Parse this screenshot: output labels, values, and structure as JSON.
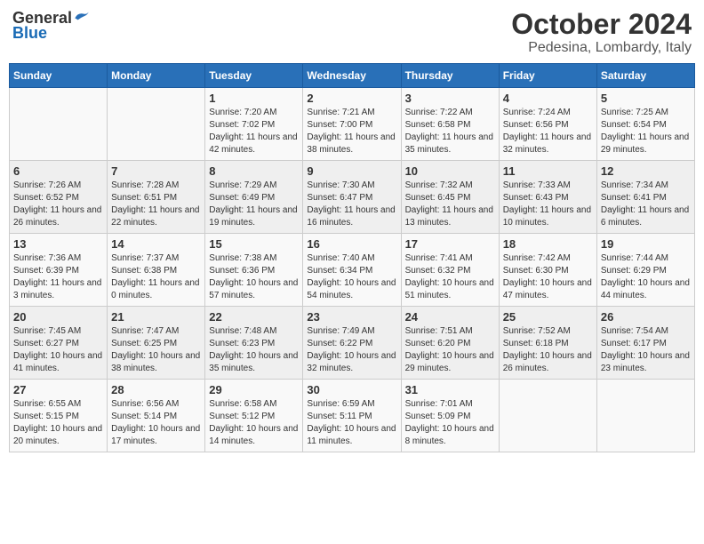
{
  "logo": {
    "general": "General",
    "blue": "Blue"
  },
  "header": {
    "month": "October 2024",
    "location": "Pedesina, Lombardy, Italy"
  },
  "weekdays": [
    "Sunday",
    "Monday",
    "Tuesday",
    "Wednesday",
    "Thursday",
    "Friday",
    "Saturday"
  ],
  "weeks": [
    [
      {
        "day": "",
        "content": ""
      },
      {
        "day": "",
        "content": ""
      },
      {
        "day": "1",
        "content": "Sunrise: 7:20 AM\nSunset: 7:02 PM\nDaylight: 11 hours and 42 minutes."
      },
      {
        "day": "2",
        "content": "Sunrise: 7:21 AM\nSunset: 7:00 PM\nDaylight: 11 hours and 38 minutes."
      },
      {
        "day": "3",
        "content": "Sunrise: 7:22 AM\nSunset: 6:58 PM\nDaylight: 11 hours and 35 minutes."
      },
      {
        "day": "4",
        "content": "Sunrise: 7:24 AM\nSunset: 6:56 PM\nDaylight: 11 hours and 32 minutes."
      },
      {
        "day": "5",
        "content": "Sunrise: 7:25 AM\nSunset: 6:54 PM\nDaylight: 11 hours and 29 minutes."
      }
    ],
    [
      {
        "day": "6",
        "content": "Sunrise: 7:26 AM\nSunset: 6:52 PM\nDaylight: 11 hours and 26 minutes."
      },
      {
        "day": "7",
        "content": "Sunrise: 7:28 AM\nSunset: 6:51 PM\nDaylight: 11 hours and 22 minutes."
      },
      {
        "day": "8",
        "content": "Sunrise: 7:29 AM\nSunset: 6:49 PM\nDaylight: 11 hours and 19 minutes."
      },
      {
        "day": "9",
        "content": "Sunrise: 7:30 AM\nSunset: 6:47 PM\nDaylight: 11 hours and 16 minutes."
      },
      {
        "day": "10",
        "content": "Sunrise: 7:32 AM\nSunset: 6:45 PM\nDaylight: 11 hours and 13 minutes."
      },
      {
        "day": "11",
        "content": "Sunrise: 7:33 AM\nSunset: 6:43 PM\nDaylight: 11 hours and 10 minutes."
      },
      {
        "day": "12",
        "content": "Sunrise: 7:34 AM\nSunset: 6:41 PM\nDaylight: 11 hours and 6 minutes."
      }
    ],
    [
      {
        "day": "13",
        "content": "Sunrise: 7:36 AM\nSunset: 6:39 PM\nDaylight: 11 hours and 3 minutes."
      },
      {
        "day": "14",
        "content": "Sunrise: 7:37 AM\nSunset: 6:38 PM\nDaylight: 11 hours and 0 minutes."
      },
      {
        "day": "15",
        "content": "Sunrise: 7:38 AM\nSunset: 6:36 PM\nDaylight: 10 hours and 57 minutes."
      },
      {
        "day": "16",
        "content": "Sunrise: 7:40 AM\nSunset: 6:34 PM\nDaylight: 10 hours and 54 minutes."
      },
      {
        "day": "17",
        "content": "Sunrise: 7:41 AM\nSunset: 6:32 PM\nDaylight: 10 hours and 51 minutes."
      },
      {
        "day": "18",
        "content": "Sunrise: 7:42 AM\nSunset: 6:30 PM\nDaylight: 10 hours and 47 minutes."
      },
      {
        "day": "19",
        "content": "Sunrise: 7:44 AM\nSunset: 6:29 PM\nDaylight: 10 hours and 44 minutes."
      }
    ],
    [
      {
        "day": "20",
        "content": "Sunrise: 7:45 AM\nSunset: 6:27 PM\nDaylight: 10 hours and 41 minutes."
      },
      {
        "day": "21",
        "content": "Sunrise: 7:47 AM\nSunset: 6:25 PM\nDaylight: 10 hours and 38 minutes."
      },
      {
        "day": "22",
        "content": "Sunrise: 7:48 AM\nSunset: 6:23 PM\nDaylight: 10 hours and 35 minutes."
      },
      {
        "day": "23",
        "content": "Sunrise: 7:49 AM\nSunset: 6:22 PM\nDaylight: 10 hours and 32 minutes."
      },
      {
        "day": "24",
        "content": "Sunrise: 7:51 AM\nSunset: 6:20 PM\nDaylight: 10 hours and 29 minutes."
      },
      {
        "day": "25",
        "content": "Sunrise: 7:52 AM\nSunset: 6:18 PM\nDaylight: 10 hours and 26 minutes."
      },
      {
        "day": "26",
        "content": "Sunrise: 7:54 AM\nSunset: 6:17 PM\nDaylight: 10 hours and 23 minutes."
      }
    ],
    [
      {
        "day": "27",
        "content": "Sunrise: 6:55 AM\nSunset: 5:15 PM\nDaylight: 10 hours and 20 minutes."
      },
      {
        "day": "28",
        "content": "Sunrise: 6:56 AM\nSunset: 5:14 PM\nDaylight: 10 hours and 17 minutes."
      },
      {
        "day": "29",
        "content": "Sunrise: 6:58 AM\nSunset: 5:12 PM\nDaylight: 10 hours and 14 minutes."
      },
      {
        "day": "30",
        "content": "Sunrise: 6:59 AM\nSunset: 5:11 PM\nDaylight: 10 hours and 11 minutes."
      },
      {
        "day": "31",
        "content": "Sunrise: 7:01 AM\nSunset: 5:09 PM\nDaylight: 10 hours and 8 minutes."
      },
      {
        "day": "",
        "content": ""
      },
      {
        "day": "",
        "content": ""
      }
    ]
  ]
}
